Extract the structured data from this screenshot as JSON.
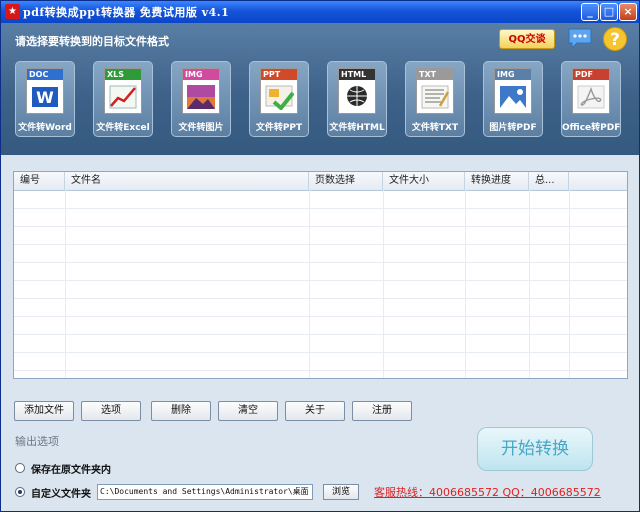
{
  "window": {
    "title": "pdf转换成ppt转换器 免费试用版 v4.1",
    "min_label": "_",
    "max_label": "□",
    "close_label": "×",
    "app_icon_label": "★"
  },
  "banner": {
    "prompt": "请选择要转换到的目标文件格式",
    "qq_label": "QQ交谈",
    "help_label": "?"
  },
  "conversions": [
    {
      "tag": "DOC",
      "label": "文件转Word",
      "color": "#2f6fd0"
    },
    {
      "tag": "XLS",
      "label": "文件转Excel",
      "color": "#2e9a3a"
    },
    {
      "tag": "IMG",
      "label": "文件转图片",
      "color": "#d14aa0"
    },
    {
      "tag": "PPT",
      "label": "文件转PPT",
      "color": "#d04a2a"
    },
    {
      "tag": "HTML",
      "label": "文件转HTML",
      "color": "#333333"
    },
    {
      "tag": "TXT",
      "label": "文件转TXT",
      "color": "#9a9a9a"
    },
    {
      "tag": "IMG",
      "label": "图片转PDF",
      "color": "#5a7fa8"
    },
    {
      "tag": "PDF",
      "label": "Office转PDF",
      "color": "#c84030"
    }
  ],
  "grid": {
    "columns": [
      "编号",
      "文件名",
      "页数选择",
      "文件大小",
      "转换进度",
      "总..."
    ],
    "rows": []
  },
  "buttons": {
    "add_file": "添加文件",
    "options": "选项",
    "delete": "删除",
    "clear": "清空",
    "about": "关于",
    "register": "注册"
  },
  "output": {
    "section_label": "输出选项",
    "option_original": "保存在原文件夹内",
    "option_custom": "自定义文件夹",
    "selected": "custom",
    "path_value": "C:\\Documents and Settings\\Administrator\\桌面",
    "browse_label": "浏览",
    "start_label": "开始转换",
    "hotline": "客服热线：4006685572 QQ：4006685572"
  }
}
